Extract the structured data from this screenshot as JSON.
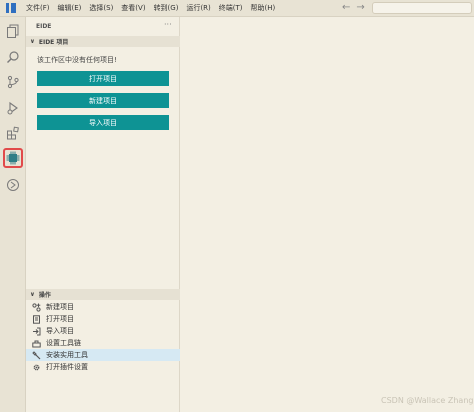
{
  "menu": [
    "文件(F)",
    "编辑(E)",
    "选择(S)",
    "查看(V)",
    "转到(G)",
    "运行(R)",
    "终端(T)",
    "帮助(H)"
  ],
  "nav": {
    "back": "←",
    "forward": "→"
  },
  "activity_bar": {
    "items": [
      {
        "icon": "explorer-icon"
      },
      {
        "icon": "search-icon"
      },
      {
        "icon": "source-control-icon"
      },
      {
        "icon": "run-debug-icon"
      },
      {
        "icon": "extensions-icon"
      },
      {
        "icon": "chip-icon",
        "active": true
      },
      {
        "icon": "platformio-icon"
      }
    ],
    "active_color": "#e14a4a"
  },
  "sidebar": {
    "title": "EIDE",
    "more": "···",
    "project_section": {
      "title": "EIDE 项目",
      "empty_message": "该工作区中没有任何项目!",
      "buttons": [
        "打开项目",
        "新建项目",
        "导入项目"
      ]
    },
    "operations_section": {
      "title": "操作",
      "items": [
        {
          "label": "新建项目",
          "icon": "new-project-icon"
        },
        {
          "label": "打开项目",
          "icon": "open-project-icon"
        },
        {
          "label": "导入项目",
          "icon": "import-project-icon"
        },
        {
          "label": "设置工具链",
          "icon": "toolchain-icon"
        },
        {
          "label": "安装实用工具",
          "icon": "install-tools-icon",
          "highlighted": true
        },
        {
          "label": "打开插件设置",
          "icon": "settings-gear-icon"
        }
      ]
    }
  },
  "colors": {
    "button": "#0e9394",
    "highlight": "#d6e9f3"
  },
  "watermark": "CSDN @Wallace Zhang"
}
